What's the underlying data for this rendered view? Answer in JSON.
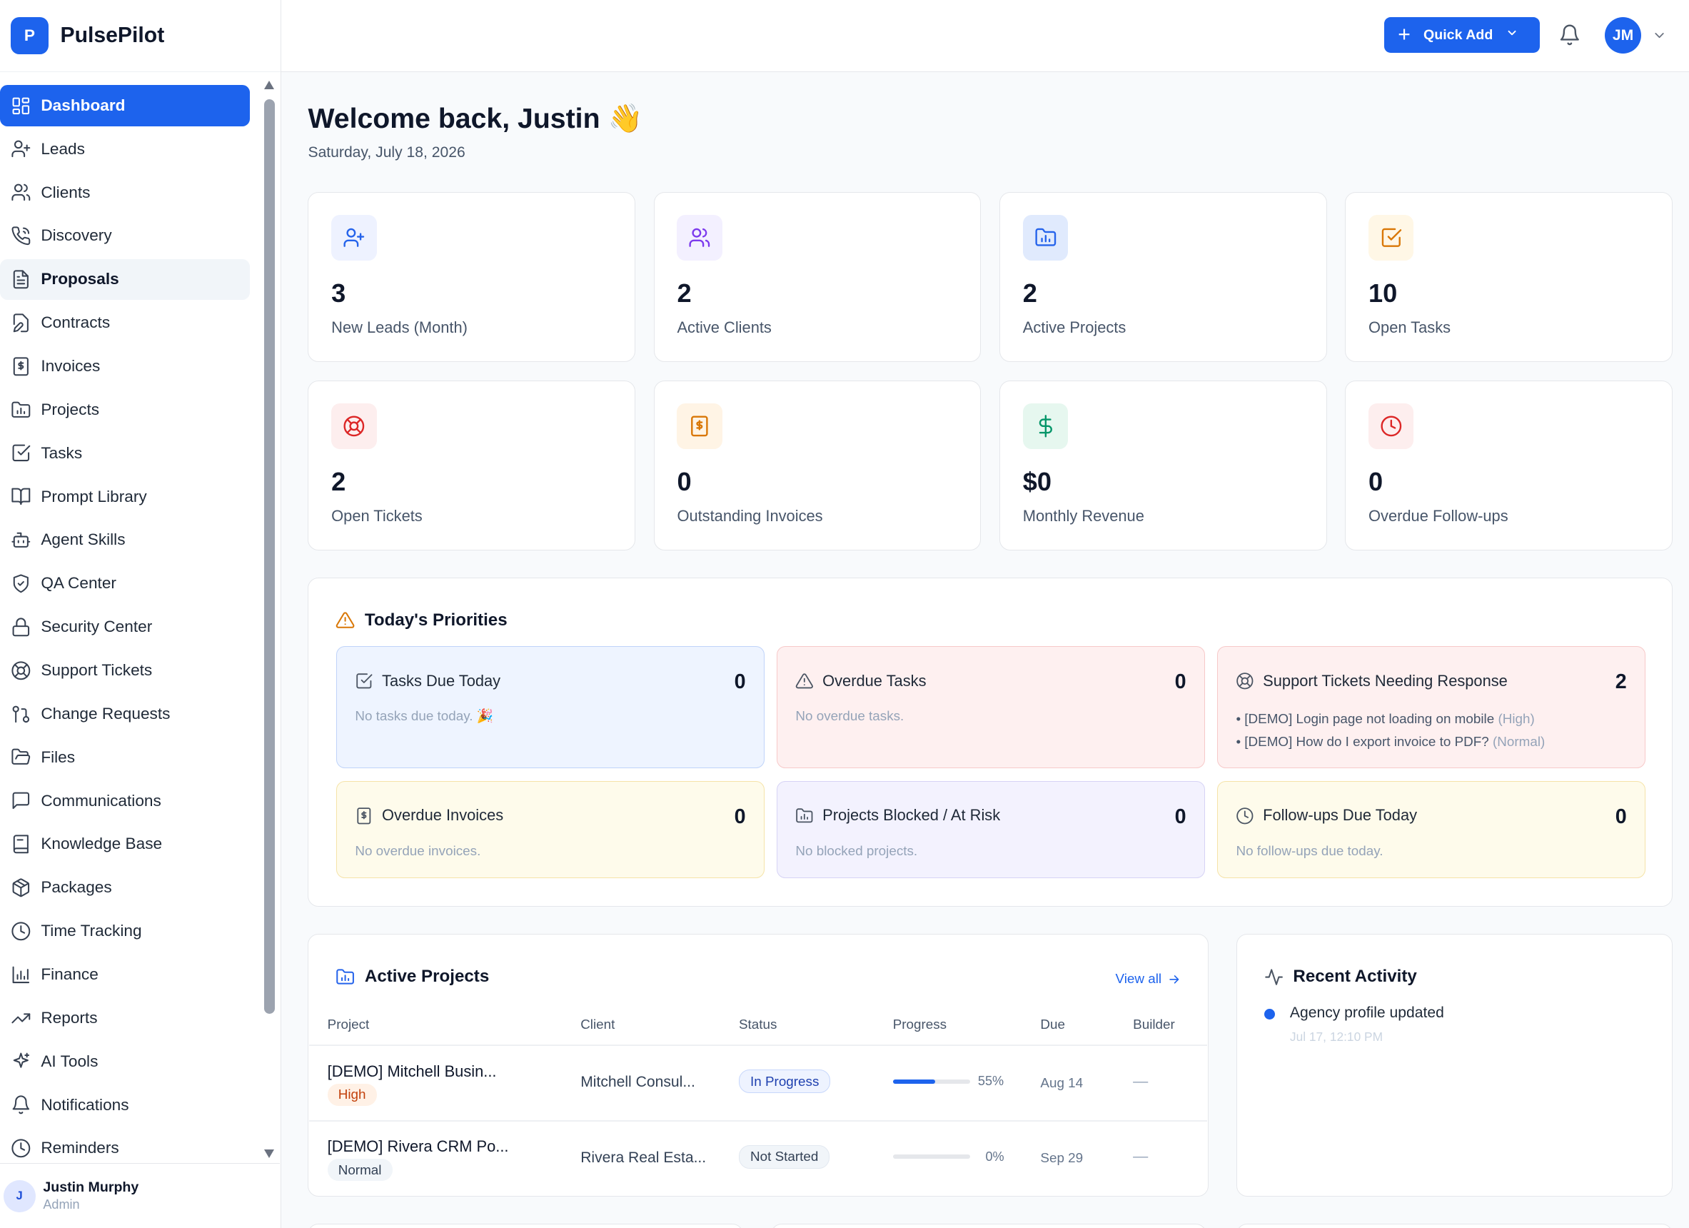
{
  "brand": {
    "logo_letter": "P",
    "name": "PulsePilot"
  },
  "sidebar": {
    "items": [
      {
        "label": "Dashboard",
        "icon": "dashboard-icon",
        "state": "active"
      },
      {
        "label": "Leads",
        "icon": "user-plus-icon"
      },
      {
        "label": "Clients",
        "icon": "users-icon"
      },
      {
        "label": "Discovery",
        "icon": "phone-icon"
      },
      {
        "label": "Proposals",
        "icon": "document-icon",
        "state": "hover"
      },
      {
        "label": "Contracts",
        "icon": "file-edit-icon"
      },
      {
        "label": "Invoices",
        "icon": "invoice-icon"
      },
      {
        "label": "Projects",
        "icon": "folder-chart-icon"
      },
      {
        "label": "Tasks",
        "icon": "checkbox-icon"
      },
      {
        "label": "Prompt Library",
        "icon": "book-open-icon"
      },
      {
        "label": "Agent Skills",
        "icon": "bot-icon"
      },
      {
        "label": "QA Center",
        "icon": "shield-check-icon"
      },
      {
        "label": "Security Center",
        "icon": "lock-icon"
      },
      {
        "label": "Support Tickets",
        "icon": "lifebuoy-icon"
      },
      {
        "label": "Change Requests",
        "icon": "git-pull-request-icon"
      },
      {
        "label": "Files",
        "icon": "folder-open-icon"
      },
      {
        "label": "Communications",
        "icon": "message-icon"
      },
      {
        "label": "Knowledge Base",
        "icon": "book-icon"
      },
      {
        "label": "Packages",
        "icon": "package-icon"
      },
      {
        "label": "Time Tracking",
        "icon": "clock-icon"
      },
      {
        "label": "Finance",
        "icon": "bar-chart-icon"
      },
      {
        "label": "Reports",
        "icon": "trending-up-icon"
      },
      {
        "label": "AI Tools",
        "icon": "sparkles-icon"
      },
      {
        "label": "Notifications",
        "icon": "bell-icon"
      },
      {
        "label": "Reminders",
        "icon": "clock-icon"
      }
    ],
    "user": {
      "initial": "J",
      "name": "Justin Murphy",
      "role": "Admin"
    }
  },
  "header": {
    "quick_add": "Quick Add",
    "avatar_initials": "JM"
  },
  "welcome": {
    "title": "Welcome back, Justin",
    "emoji": "👋",
    "date": "Saturday, July 18, 2026"
  },
  "stats": [
    {
      "value": "3",
      "label": "New Leads (Month)",
      "icon": "user-plus-icon",
      "color": "#2563eb",
      "bg": "#eef2ff"
    },
    {
      "value": "2",
      "label": "Active Clients",
      "icon": "users-icon",
      "color": "#7c3aed",
      "bg": "#f3f0ff"
    },
    {
      "value": "2",
      "label": "Active Projects",
      "icon": "folder-chart-icon",
      "color": "#2563eb",
      "bg": "#e0eafd"
    },
    {
      "value": "10",
      "label": "Open Tasks",
      "icon": "checkbox-icon",
      "color": "#d97706",
      "bg": "#fff7e6"
    },
    {
      "value": "2",
      "label": "Open Tickets",
      "icon": "lifebuoy-icon",
      "color": "#dc2626",
      "bg": "#fdeeee"
    },
    {
      "value": "0",
      "label": "Outstanding Invoices",
      "icon": "invoice-icon",
      "color": "#d97706",
      "bg": "#fff4e5"
    },
    {
      "value": "$0",
      "label": "Monthly Revenue",
      "icon": "dollar-icon",
      "color": "#059669",
      "bg": "#e6f7ef"
    },
    {
      "value": "0",
      "label": "Overdue Follow-ups",
      "icon": "clock-icon",
      "color": "#dc2626",
      "bg": "#fdeeee"
    }
  ],
  "priorities": {
    "title": "Today's Priorities",
    "cards": [
      {
        "title": "Tasks Due Today",
        "count": "0",
        "empty": "No tasks due today. 🎉",
        "icon": "checkbox-icon",
        "bg": "#eef4ff",
        "border": "#bfd3f9"
      },
      {
        "title": "Overdue Tasks",
        "count": "0",
        "empty": "No overdue tasks.",
        "icon": "warning-icon",
        "bg": "#fef0f0",
        "border": "#f7c9c9"
      },
      {
        "title": "Support Tickets Needing Response",
        "count": "2",
        "icon": "lifebuoy-icon",
        "bg": "#fef0f0",
        "border": "#f7c9c9",
        "items": [
          {
            "text": "• [DEMO] Login page not loading on mobile",
            "tag": "(High)"
          },
          {
            "text": "• [DEMO] How do I export invoice to PDF?",
            "tag": "(Normal)"
          }
        ]
      },
      {
        "title": "Overdue Invoices",
        "count": "0",
        "empty": "No overdue invoices.",
        "icon": "invoice-icon",
        "bg": "#fefbeb",
        "border": "#f5e3a8"
      },
      {
        "title": "Projects Blocked / At Risk",
        "count": "0",
        "empty": "No blocked projects.",
        "icon": "folder-chart-icon",
        "bg": "#f3f2fe",
        "border": "#d6d3f5"
      },
      {
        "title": "Follow-ups Due Today",
        "count": "0",
        "empty": "No follow-ups due today.",
        "icon": "clock-icon",
        "bg": "#fefbeb",
        "border": "#f5e3a8"
      }
    ]
  },
  "projects": {
    "title": "Active Projects",
    "view_all": "View all",
    "columns": [
      "Project",
      "Client",
      "Status",
      "Progress",
      "Due",
      "Builder"
    ],
    "rows": [
      {
        "name": "[DEMO] Mitchell Busin...",
        "priority": "High",
        "client": "Mitchell Consul...",
        "status": "In Progress",
        "progress": 55,
        "progress_label": "55%",
        "due": "Aug 14",
        "builder": "—"
      },
      {
        "name": "[DEMO] Rivera CRM Po...",
        "priority": "Normal",
        "client": "Rivera Real Esta...",
        "status": "Not Started",
        "progress": 0,
        "progress_label": "0%",
        "due": "Sep 29",
        "builder": "—"
      }
    ]
  },
  "activity": {
    "title": "Recent Activity",
    "items": [
      {
        "text": "Agency profile updated",
        "time": "Jul 17, 12:10 PM"
      }
    ]
  }
}
